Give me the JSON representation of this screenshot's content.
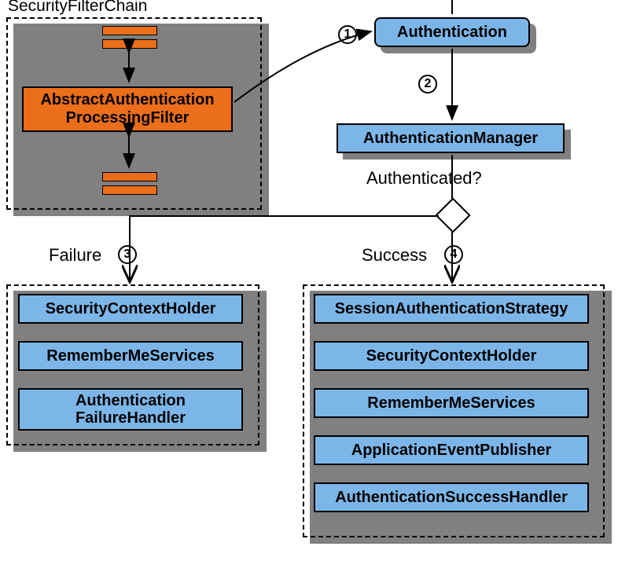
{
  "filterChain": {
    "title": "SecurityFilterChain",
    "mainFilter": "AbstractAuthentication\nProcessingFilter"
  },
  "steps": {
    "s1": "1",
    "s2": "2",
    "s3": "3",
    "s4": "4"
  },
  "nodes": {
    "authentication": "Authentication",
    "authManager": "AuthenticationManager",
    "authenticatedQ": "Authenticated?"
  },
  "branches": {
    "failure": {
      "title": "Failure",
      "items": [
        "SecurityContextHolder",
        "RememberMeServices",
        "Authentication\nFailureHandler"
      ]
    },
    "success": {
      "title": "Success",
      "items": [
        "SessionAuthenticationStrategy",
        "SecurityContextHolder",
        "RememberMeServices",
        "ApplicationEventPublisher",
        "AuthenticationSuccessHandler"
      ]
    }
  }
}
